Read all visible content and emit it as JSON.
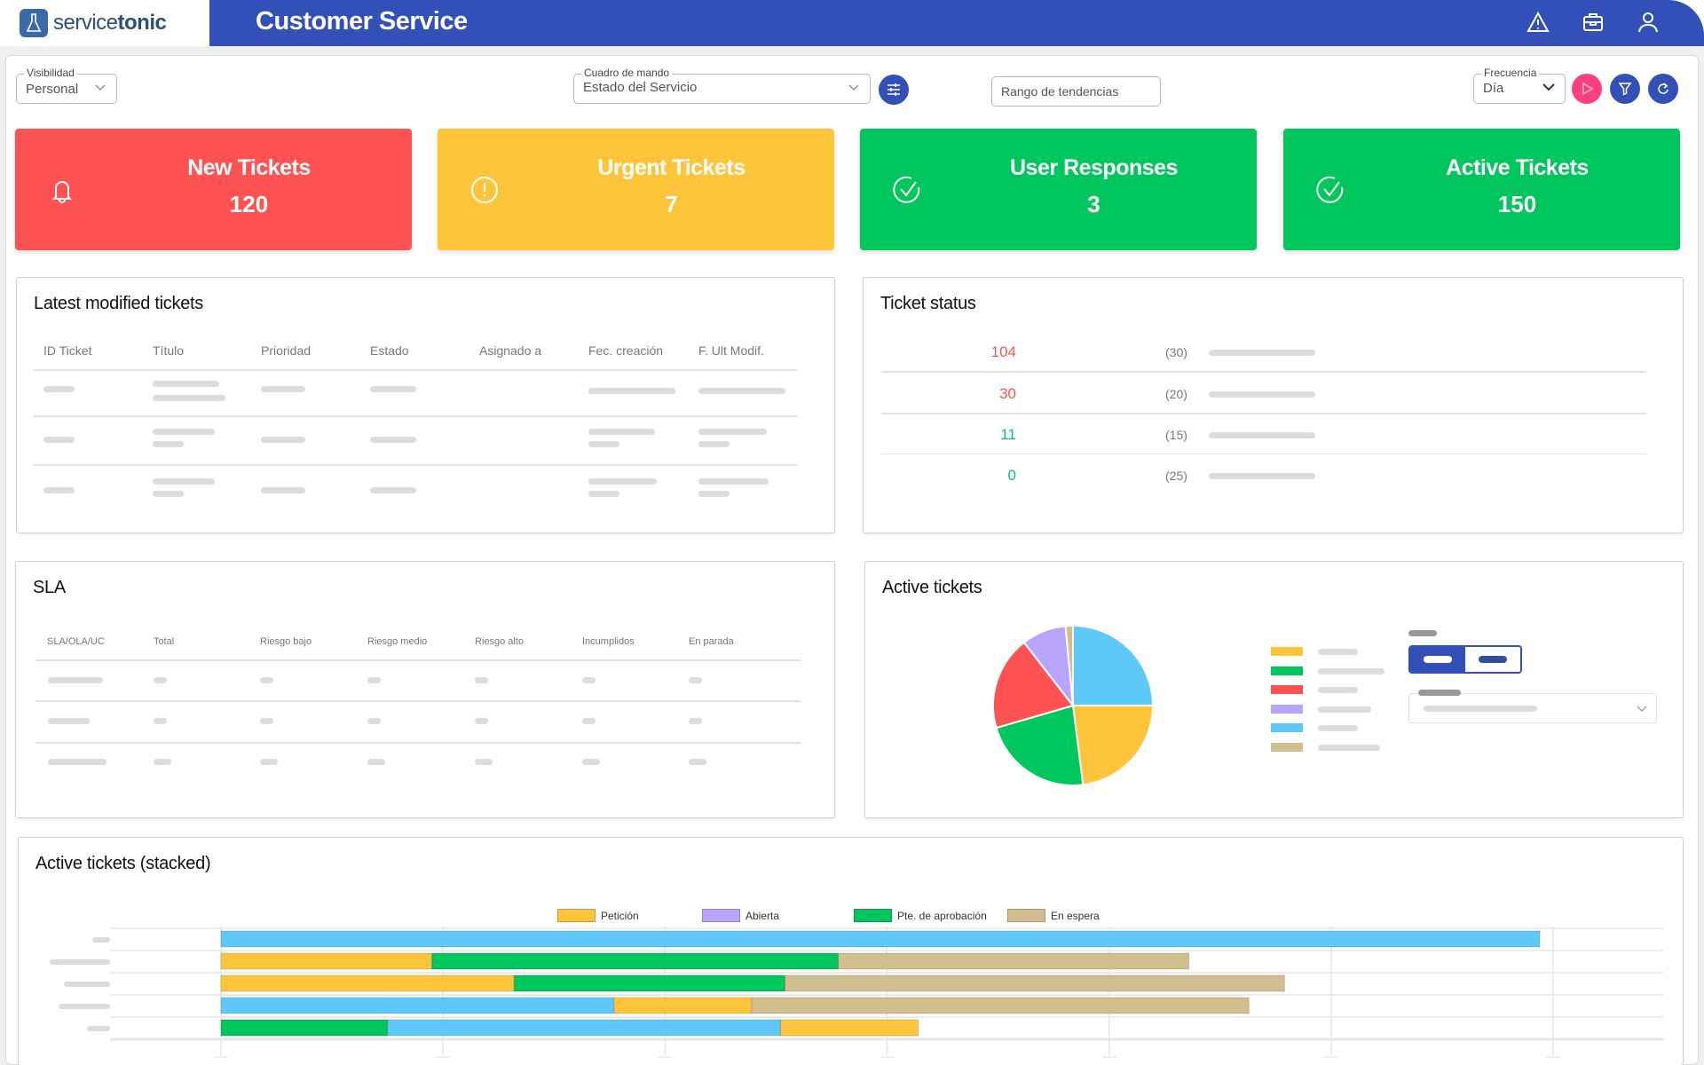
{
  "header": {
    "brand_light": "service",
    "brand_bold": "tonic",
    "title": "Customer Service",
    "icons": [
      "warning-icon",
      "briefcase-icon",
      "user-icon"
    ]
  },
  "filters": {
    "visibilidad": {
      "label": "Visibilidad",
      "value": "Personal"
    },
    "cuadro": {
      "label": "Cuadro de mando",
      "value": "Estado del Servicio"
    },
    "rango": {
      "placeholder": "Rango de tendencias"
    },
    "frecuencia": {
      "label": "Frecuencia",
      "value": "Día"
    }
  },
  "colors": {
    "brand": "#334fb8",
    "red": "#ff5252",
    "yellow": "#ffc53a",
    "green": "#00c65e",
    "pink": "#ff3f7f",
    "blue_light": "#5ec8f8",
    "purple": "#b8a4fb",
    "tan": "#d2bf8f"
  },
  "kpis": [
    {
      "title": "New Tickets",
      "value": "120",
      "icon": "bell-icon",
      "color": "#ff5252"
    },
    {
      "title": "Urgent Tickets",
      "value": "7",
      "icon": "alert-circle-icon",
      "color": "#ffc53a"
    },
    {
      "title": "User Responses",
      "value": "3",
      "icon": "check-circle-icon",
      "color": "#00c65e"
    },
    {
      "title": "Active Tickets",
      "value": "150",
      "icon": "check-circle-icon",
      "color": "#00c65e"
    }
  ],
  "latest": {
    "title": "Latest modified tickets",
    "columns": [
      "ID Ticket",
      "Título",
      "Prioridad",
      "Estado",
      "Asignado a",
      "Fec. creación",
      "F. Ult Modif."
    ]
  },
  "ticket_status": {
    "title": "Ticket status",
    "rows": [
      {
        "value": "104",
        "count": "(30)",
        "color": "#ff5252"
      },
      {
        "value": "30",
        "count": "(20)",
        "color": "#ff5252"
      },
      {
        "value": "11",
        "count": "(15)",
        "color": "#00c65e"
      },
      {
        "value": "0",
        "count": "(25)",
        "color": "#00c65e"
      }
    ]
  },
  "sla": {
    "title": "SLA",
    "columns": [
      "SLA/OLA/UC",
      "Total",
      "Riesgo bajo",
      "Riesgo medio",
      "Riesgo alto",
      "Incumplidos",
      "En parada"
    ]
  },
  "active": {
    "title": "Active tickets"
  },
  "stacked": {
    "title": "Active tickets (stacked)"
  },
  "chart_data": [
    {
      "type": "pie",
      "title": "Active tickets",
      "slices": [
        {
          "color": "#5ec8f8",
          "value": 25
        },
        {
          "color": "#ffc53a",
          "value": 23
        },
        {
          "color": "#00c65e",
          "value": 22.5
        },
        {
          "color": "#ff5252",
          "value": 19
        },
        {
          "color": "#b8a4fb",
          "value": 9
        },
        {
          "color": "#d2bf8f",
          "value": 1.5
        }
      ],
      "legend_colors": [
        "#ffc53a",
        "#00c65e",
        "#ff5252",
        "#b8a4fb",
        "#5ec8f8",
        "#d2bf8f"
      ],
      "legend": "right"
    },
    {
      "type": "bar",
      "orientation": "horizontal",
      "stacked": true,
      "title": "Active tickets (stacked)",
      "legend": [
        "Petición",
        "Abierta",
        "Pte. de aprobación",
        "En espera"
      ],
      "legend_colors": [
        "#ffc53a",
        "#b8a4fb",
        "#00c65e",
        "#d2bf8f"
      ],
      "legend_position": "top",
      "grid": true,
      "xlim": [
        0,
        60
      ],
      "x_ticks": [
        0,
        10,
        20,
        30,
        40,
        50,
        60
      ],
      "rows": [
        [
          {
            "color": "#5ec8f8",
            "value": 59.4
          }
        ],
        [
          {
            "color": "#ffc53a",
            "value": 9.5
          },
          {
            "color": "#00c65e",
            "value": 18.3
          },
          {
            "color": "#d2bf8f",
            "value": 15.8
          }
        ],
        [
          {
            "color": "#ffc53a",
            "value": 13.2
          },
          {
            "color": "#00c65e",
            "value": 12.2
          },
          {
            "color": "#d2bf8f",
            "value": 22.5
          }
        ],
        [
          {
            "color": "#5ec8f8",
            "value": 17.7
          },
          {
            "color": "#ffc53a",
            "value": 6.2
          },
          {
            "color": "#d2bf8f",
            "value": 22.4
          }
        ],
        [
          {
            "color": "#00c65e",
            "value": 7.5
          },
          {
            "color": "#5ec8f8",
            "value": 17.7
          },
          {
            "color": "#ffc53a",
            "value": 6.2
          }
        ]
      ]
    }
  ]
}
